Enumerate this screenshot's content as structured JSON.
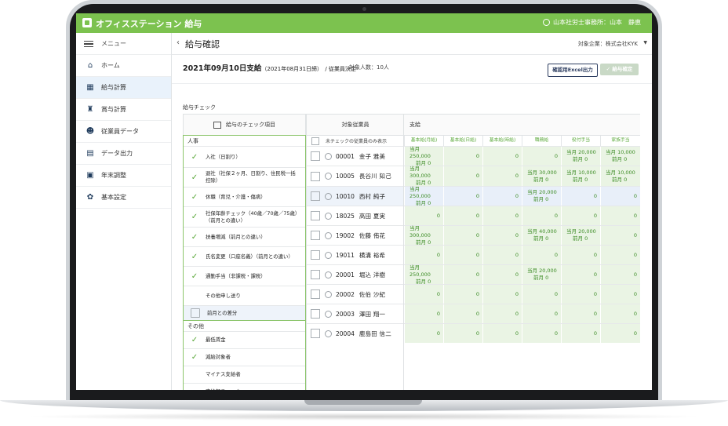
{
  "app": {
    "title": "オフィスステーション 給与",
    "user": "山本社労士事務所：山本　静恵"
  },
  "sidebar": {
    "menu_label": "メニュー",
    "items": [
      {
        "label": "ホーム",
        "icon": "home-icon",
        "active": false
      },
      {
        "label": "給与計算",
        "icon": "calculator-icon",
        "active": true
      },
      {
        "label": "賞与計算",
        "icon": "trophy-icon",
        "active": false
      },
      {
        "label": "従業員データ",
        "icon": "people-icon",
        "active": false
      },
      {
        "label": "データ出力",
        "icon": "printer-icon",
        "active": false
      },
      {
        "label": "年末調整",
        "icon": "document-icon",
        "active": false
      },
      {
        "label": "基本設定",
        "icon": "gear-icon",
        "active": false
      }
    ]
  },
  "header": {
    "back": "‹",
    "title": "給与確認",
    "company": "対象企業：株式会社KYK",
    "caret": "▼"
  },
  "summary": {
    "payday": "2021年09月10日支給",
    "closing": "（2021年08月31日締）",
    "status": "/ 従業員決定",
    "count": "対象人数：10人",
    "excel_button": "確認用Excel出力",
    "confirm_button": "✓ 給与確定"
  },
  "check": {
    "section": "給与チェック",
    "header": "給与のチェック項目",
    "groups": [
      {
        "label": "人事",
        "items": [
          {
            "text": "入社（日割り）",
            "checked": true,
            "lines": 1
          },
          {
            "text": "退社（社保２ヶ月、日割り、住民税一括控除）",
            "checked": true,
            "lines": 2
          },
          {
            "text": "休職（育児・介護・傷病）",
            "checked": true,
            "lines": 1
          },
          {
            "text": "社保年齢チェック（40歳／70歳／75歳）（前月との違い）",
            "checked": true,
            "lines": 2
          },
          {
            "text": "扶養増減（前月との違い）",
            "checked": true,
            "lines": 1
          },
          {
            "text": "氏名変更（口座名義）（前月との違い）",
            "checked": true,
            "lines": 1
          },
          {
            "text": "通勤手当（非課税・課税）",
            "checked": true,
            "lines": 1
          },
          {
            "text": "その他申し送り",
            "checked": false,
            "lines": 1,
            "box": false
          },
          {
            "text": "前月との差分",
            "checked": false,
            "lines": 1,
            "box": true,
            "hl": true
          }
        ]
      },
      {
        "label": "その他",
        "items": [
          {
            "text": "最低賃金",
            "checked": true,
            "lines": 1
          },
          {
            "text": "減給対象者",
            "checked": true,
            "lines": 1
          },
          {
            "text": "マイナス支給者",
            "checked": false,
            "lines": 1,
            "box": false
          },
          {
            "text": "支給額チェック",
            "checked": false,
            "lines": 1,
            "box": false
          }
        ]
      }
    ]
  },
  "employees": {
    "header": "対象従業員",
    "filter": "未チェックの従業員のみ表示",
    "rows": [
      {
        "id": "00001",
        "name": "金子 雅美"
      },
      {
        "id": "10005",
        "name": "長谷川 知己"
      },
      {
        "id": "10010",
        "name": "西村 純子"
      },
      {
        "id": "18025",
        "name": "高田 夏実"
      },
      {
        "id": "19002",
        "name": "佐藤 侑花"
      },
      {
        "id": "19011",
        "name": "横溝 裕希"
      },
      {
        "id": "20001",
        "name": "堀込 洋樹"
      },
      {
        "id": "20002",
        "name": "佐伯 沙紀"
      },
      {
        "id": "20003",
        "name": "澤田 翔一"
      },
      {
        "id": "20004",
        "name": "鹿島田 信二"
      }
    ]
  },
  "payment": {
    "header": "支給",
    "columns": [
      "基本給(月給)",
      "基本給(日給)",
      "基本給(時給)",
      "職務給",
      "役付手当",
      "家族手当"
    ],
    "rows": [
      {
        "cells": [
          [
            "当月 250,000",
            "前月 0"
          ],
          [
            "0"
          ],
          [
            "0"
          ],
          [
            "0"
          ],
          [
            "当月 20,000",
            "前月 0"
          ],
          [
            "当月 10,000",
            "前月 0"
          ]
        ]
      },
      {
        "cells": [
          [
            "当月 300,000",
            "前月 0"
          ],
          [
            "0"
          ],
          [
            "0"
          ],
          [
            "当月 30,000",
            "前月 0"
          ],
          [
            "当月 10,000",
            "前月 0"
          ],
          [
            "当月 10,000",
            "前月 0"
          ]
        ]
      },
      {
        "cells": [
          [
            "当月 250,000",
            "前月 0"
          ],
          [
            "0"
          ],
          [
            "0"
          ],
          [
            "当月 20,000",
            "前月 0"
          ],
          [
            "0"
          ],
          [
            "0"
          ]
        ]
      },
      {
        "cells": [
          [
            "0"
          ],
          [
            "0"
          ],
          [
            "0"
          ],
          [
            "0"
          ],
          [
            "0"
          ],
          [
            "0"
          ]
        ]
      },
      {
        "cells": [
          [
            "当月 300,000",
            "前月 0"
          ],
          [
            "0"
          ],
          [
            "0"
          ],
          [
            "当月 40,000",
            "前月 0"
          ],
          [
            "当月 20,000",
            "前月 0"
          ],
          [
            "0"
          ]
        ]
      },
      {
        "cells": [
          [
            "0"
          ],
          [
            "0"
          ],
          [
            "0"
          ],
          [
            "0"
          ],
          [
            "0"
          ],
          [
            "0"
          ]
        ]
      },
      {
        "cells": [
          [
            "当月 250,000",
            "前月 0"
          ],
          [
            "0"
          ],
          [
            "0"
          ],
          [
            "当月 20,000",
            "前月 0"
          ],
          [
            "0"
          ],
          [
            "0"
          ]
        ]
      },
      {
        "cells": [
          [
            "0"
          ],
          [
            "0"
          ],
          [
            "0"
          ],
          [
            "0"
          ],
          [
            "0"
          ],
          [
            "0"
          ]
        ]
      },
      {
        "cells": [
          [
            "0"
          ],
          [
            "0"
          ],
          [
            "0"
          ],
          [
            "0"
          ],
          [
            "0"
          ],
          [
            "0"
          ]
        ]
      },
      {
        "cells": [
          [
            "0"
          ],
          [
            "0"
          ],
          [
            "0"
          ],
          [
            "0"
          ],
          [
            "0"
          ],
          [
            "0"
          ]
        ]
      }
    ]
  },
  "colors": {
    "brand": "#7cc24f",
    "accent": "#5aa83a",
    "navy": "#2d3d60"
  }
}
